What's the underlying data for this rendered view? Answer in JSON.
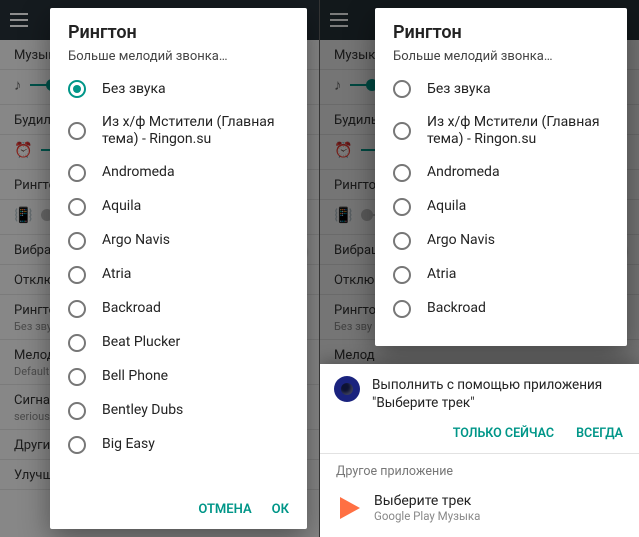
{
  "bg": {
    "labels": {
      "music": "Музык",
      "alarm": "Будиль",
      "ringtone": "Рингто",
      "vibrate": "Вибраш",
      "dnd": "Отклю",
      "ringtoneSel": "Рингто",
      "ringtoneSub": "Без зву",
      "melody": "Мелод",
      "melodySub": "Default",
      "signal": "Сигнал",
      "signalSub": "serious_ … encounte",
      "other": "Другие",
      "improve": "Улучш"
    }
  },
  "dialog": {
    "title": "Рингтон",
    "more": "Больше мелодий звонка…",
    "options": [
      {
        "label": "Без звука",
        "selected": true
      },
      {
        "label": "Из х/ф Мстители (Главная тема) - Ringon.su",
        "selected": false
      },
      {
        "label": "Andromeda",
        "selected": false
      },
      {
        "label": "Aquila",
        "selected": false
      },
      {
        "label": "Argo Navis",
        "selected": false
      },
      {
        "label": "Atria",
        "selected": false
      },
      {
        "label": "Backroad",
        "selected": false
      },
      {
        "label": "Beat Plucker",
        "selected": false
      },
      {
        "label": "Bell Phone",
        "selected": false
      },
      {
        "label": "Bentley Dubs",
        "selected": false
      },
      {
        "label": "Big Easy",
        "selected": false
      }
    ],
    "rightCount": 7,
    "cancel": "ОТМЕНА",
    "ok": "ОК"
  },
  "sheet": {
    "headline": "Выполнить с помощью приложения \"Выберите трек\"",
    "justOnce": "ТОЛЬКО СЕЙЧАС",
    "always": "ВСЕГДА",
    "otherLabel": "Другое приложение",
    "appName": "Выберите трек",
    "appSub": "Google Play Музыка"
  }
}
